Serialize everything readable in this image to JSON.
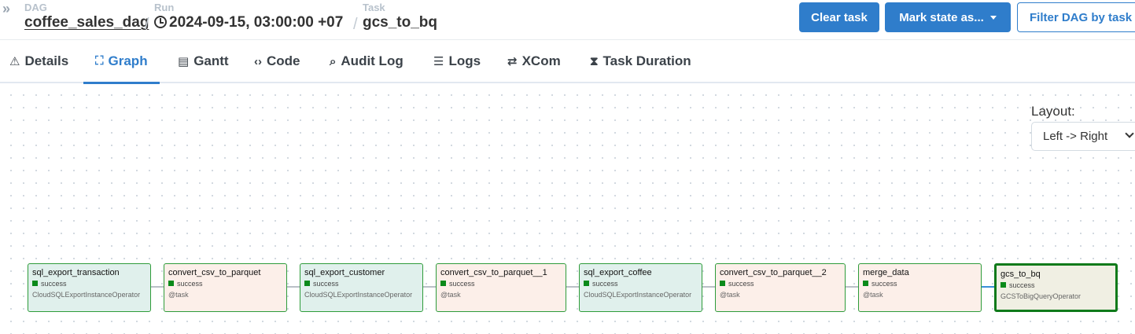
{
  "header": {
    "dag": {
      "label": "DAG",
      "value": "coffee_sales_dag"
    },
    "run": {
      "label": "Run",
      "value": "2024-09-15, 03:00:00 +07"
    },
    "task": {
      "label": "Task",
      "value": "gcs_to_bq"
    },
    "separator": "/",
    "collapse_icon": "double-chevron-right-icon",
    "buttons": {
      "clear": "Clear task",
      "mark_state": "Mark state as...",
      "filter": "Filter DAG by task"
    },
    "colors": {
      "primary": "#2f7dcb"
    }
  },
  "tabs": [
    {
      "label": "Details",
      "icon": "warning-triangle-icon",
      "glyph": "⚠",
      "active": false
    },
    {
      "label": "Graph",
      "icon": "graph-icon",
      "glyph": "⛶",
      "active": true
    },
    {
      "label": "Gantt",
      "icon": "gantt-icon",
      "glyph": "▤",
      "active": false
    },
    {
      "label": "Code",
      "icon": "code-icon",
      "glyph": "‹›",
      "active": false
    },
    {
      "label": "Audit Log",
      "icon": "audit-log-icon",
      "glyph": "🔍",
      "active": false
    },
    {
      "label": "Logs",
      "icon": "logs-icon",
      "glyph": "☰",
      "active": false
    },
    {
      "label": "XCom",
      "icon": "xcom-icon",
      "glyph": "⇄",
      "active": false
    },
    {
      "label": "Task Duration",
      "icon": "hourglass-icon",
      "glyph": "⧗",
      "active": false
    }
  ],
  "graph": {
    "layout_label": "Layout:",
    "layout_value": "Left -> Right",
    "nodes": [
      {
        "name": "sql_export_transaction",
        "state": "success",
        "operator": "CloudSQLExportInstanceOperator",
        "kind": "op"
      },
      {
        "name": "convert_csv_to_parquet",
        "state": "success",
        "operator": "@task",
        "kind": "tk"
      },
      {
        "name": "sql_export_customer",
        "state": "success",
        "operator": "CloudSQLExportInstanceOperator",
        "kind": "op"
      },
      {
        "name": "convert_csv_to_parquet__1",
        "state": "success",
        "operator": "@task",
        "kind": "tk"
      },
      {
        "name": "sql_export_coffee",
        "state": "success",
        "operator": "CloudSQLExportInstanceOperator",
        "kind": "op"
      },
      {
        "name": "convert_csv_to_parquet__2",
        "state": "success",
        "operator": "@task",
        "kind": "tk"
      },
      {
        "name": "merge_data",
        "state": "success",
        "operator": "@task",
        "kind": "tk"
      },
      {
        "name": "gcs_to_bq",
        "state": "success",
        "operator": "GCSToBigQueryOperator",
        "kind": "sel"
      }
    ],
    "colors": {
      "success": "#0a8a1a",
      "operator_node": "#e0f0ec",
      "task_node": "#fcefe9",
      "selected_node": "#f0efe3",
      "active_edge": "#3a8fd8"
    }
  }
}
